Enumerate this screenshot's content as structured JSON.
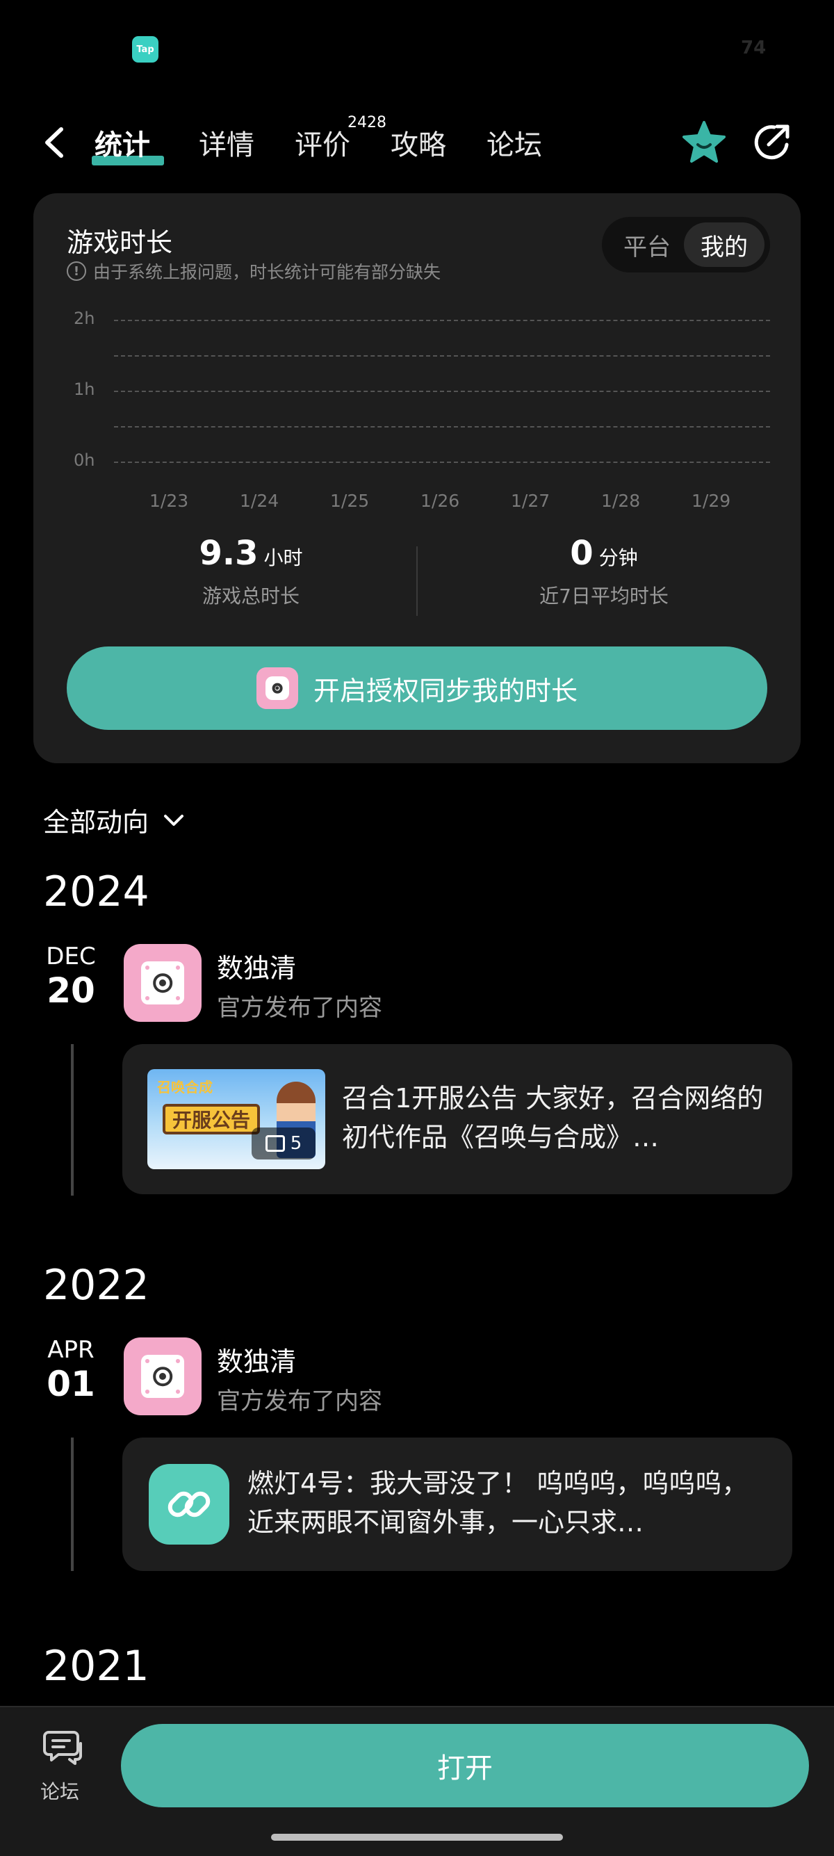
{
  "status": {
    "app_icon_text": "Tap",
    "battery": "74"
  },
  "nav": {
    "tabs": [
      {
        "label": "统计",
        "active": true
      },
      {
        "label": "详情"
      },
      {
        "label": "评价",
        "badge": "2428"
      },
      {
        "label": "攻略"
      },
      {
        "label": "论坛"
      }
    ]
  },
  "stats": {
    "title": "游戏时长",
    "notice": "由于系统上报问题，时长统计可能有部分缺失",
    "toggle": {
      "platform": "平台",
      "mine": "我的",
      "selected": "我的"
    },
    "chart_data": {
      "type": "bar",
      "categories": [
        "1/23",
        "1/24",
        "1/25",
        "1/26",
        "1/27",
        "1/28",
        "1/29"
      ],
      "values": [
        0,
        0,
        0,
        0,
        0,
        0,
        0
      ],
      "y_ticks": [
        "2h",
        "1h",
        "0h"
      ],
      "ylim": [
        0,
        2
      ],
      "grid": true
    },
    "total": {
      "value": "9.3",
      "unit": "小时",
      "label": "游戏总时长"
    },
    "avg": {
      "value": "0",
      "unit": "分钟",
      "label": "近7日平均时长"
    },
    "sync_button": "开启授权同步我的时长"
  },
  "feed": {
    "filter_label": "全部动向",
    "groups": [
      {
        "year": "2024",
        "month": "DEC",
        "day": "20",
        "author": "数独清",
        "action": "官方发布了内容",
        "text": "召合1开服公告 大家好，召合网络的初代作品《召唤与合成》…",
        "thumb_title": "召唤合成",
        "thumb_sign": "开服公告",
        "image_count": "5"
      },
      {
        "year": "2022",
        "month": "APR",
        "day": "01",
        "author": "数独清",
        "action": "官方发布了内容",
        "text": "燃灯4号：我大哥没了！ 呜呜呜，呜呜呜，近来两眼不闻窗外事，一心只求…"
      },
      {
        "year": "2021"
      }
    ]
  },
  "bottom": {
    "forum_label": "论坛",
    "open_button": "打开"
  },
  "colors": {
    "accent": "#4db6a7",
    "card": "#1e1e1e",
    "app_icon": "#f4a9c9"
  }
}
